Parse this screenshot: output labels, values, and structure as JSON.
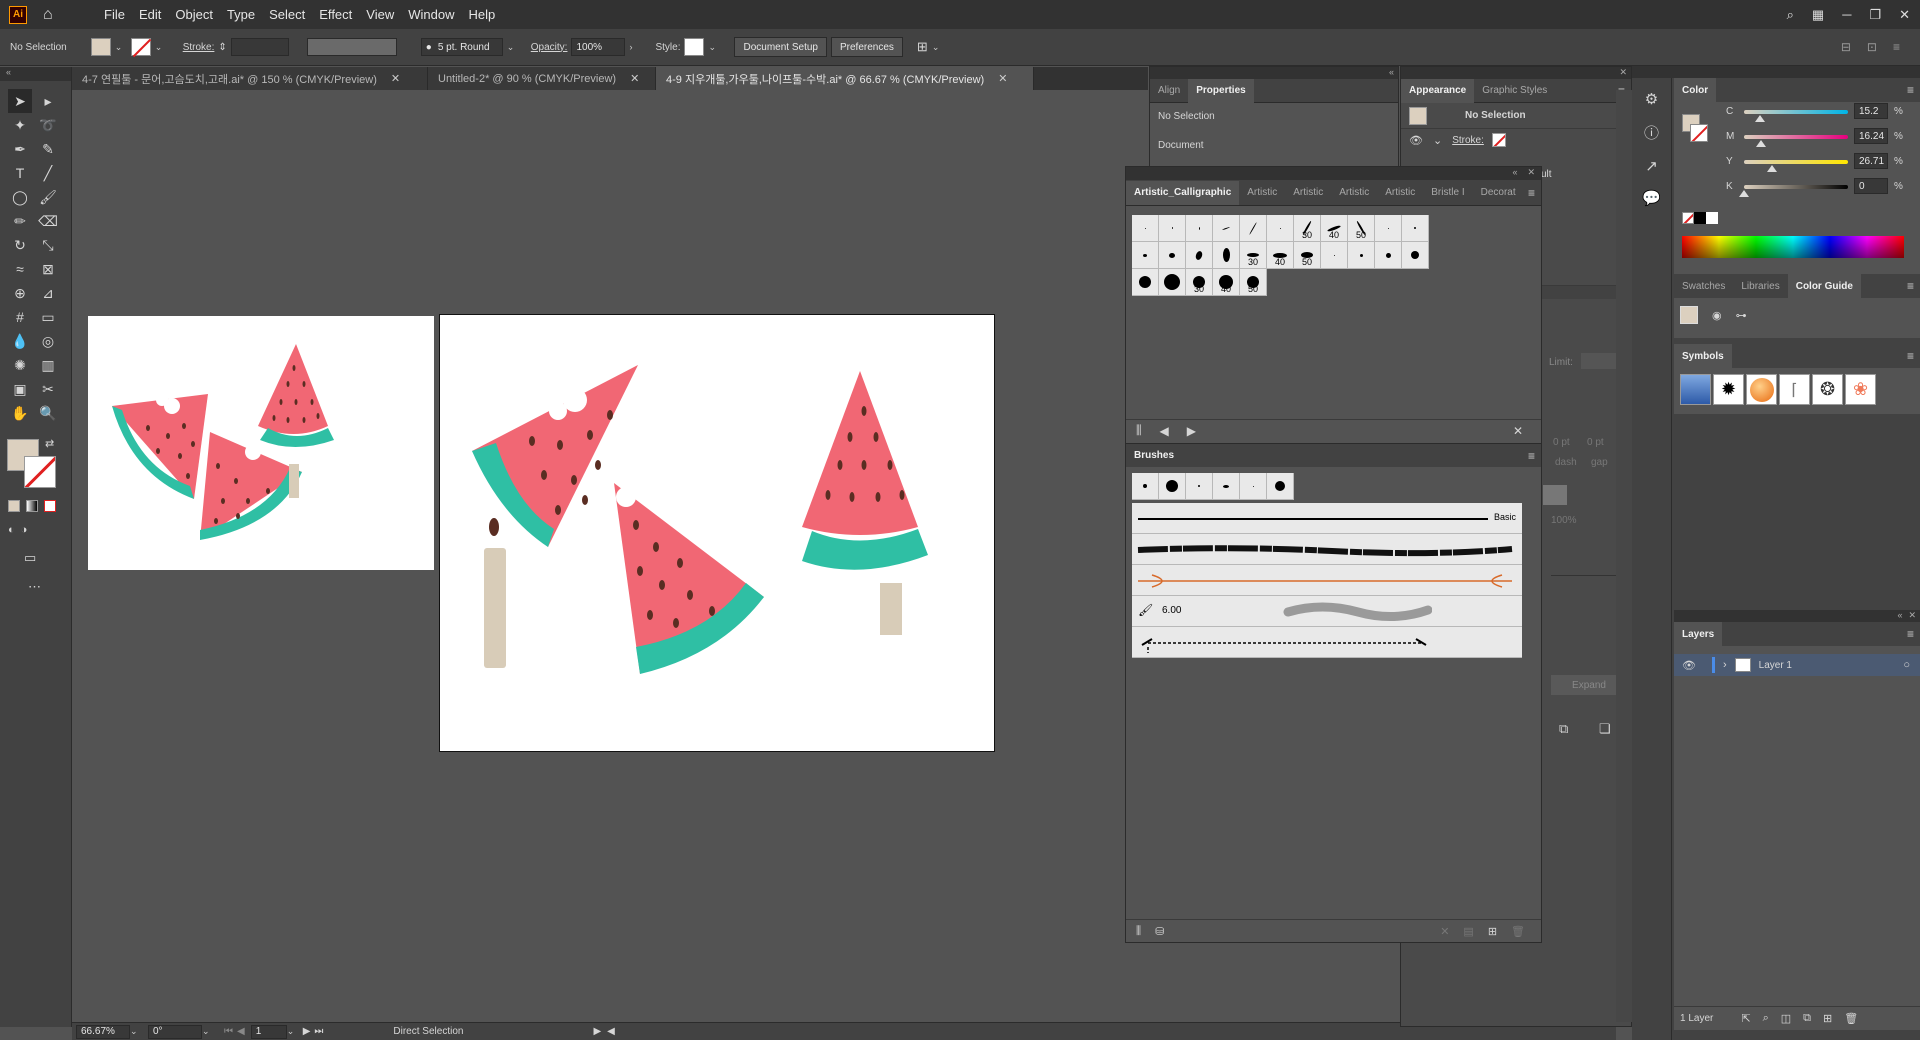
{
  "app": {
    "logo": "Ai",
    "menus": [
      "File",
      "Edit",
      "Object",
      "Type",
      "Select",
      "Effect",
      "View",
      "Window",
      "Help"
    ]
  },
  "control": {
    "selection": "No Selection",
    "stroke_label": "Stroke:",
    "brush_value": "5 pt. Round",
    "opacity_label": "Opacity:",
    "opacity_value": "100%",
    "style_label": "Style:",
    "doc_setup": "Document Setup",
    "preferences": "Preferences"
  },
  "tabs": [
    {
      "label": "4-7 연필툴 - 문어,고슴도치,고래.ai* @ 150 % (CMYK/Preview)",
      "active": false
    },
    {
      "label": "Untitled-2* @ 90 % (CMYK/Preview)",
      "active": false
    },
    {
      "label": "4-9 지우개툴,가우툴,나이프툴-수박.ai* @ 66.67 % (CMYK/Preview)",
      "active": true
    }
  ],
  "status": {
    "zoom": "66.67%",
    "rotation": "0°",
    "artboard": "1",
    "tool": "Direct Selection"
  },
  "properties_panel": {
    "tabs": [
      "Align",
      "Properties"
    ],
    "no_selection": "No Selection",
    "document": "Document"
  },
  "appearance_panel": {
    "tabs": [
      "Appearance",
      "Graphic Styles"
    ],
    "no_selection": "No Selection",
    "stroke": "Stroke:",
    "limit": "Limit:",
    "dash": "dash",
    "gap": "gap",
    "pt0": "0 pt",
    "pt1": "0 pt",
    "pct": "100%",
    "expand": "Expand",
    "ult": "ult"
  },
  "brush_library": {
    "tabs": [
      "Artistic_Calligraphic",
      "Artistic",
      "Artistic",
      "Artistic",
      "Artistic",
      "Bristle I",
      "Decorat"
    ],
    "row1_labels": [
      "",
      "",
      "",
      "",
      "",
      "",
      "30",
      "40",
      "50",
      "",
      ""
    ],
    "row2_labels": [
      "",
      "",
      "",
      "",
      "30",
      "40",
      "50",
      "",
      "",
      "",
      ""
    ],
    "row3_labels": [
      "",
      "",
      "30",
      "40",
      "50"
    ]
  },
  "brushes_panel": {
    "title": "Brushes",
    "basic": "Basic",
    "size": "6.00"
  },
  "color_panel": {
    "title": "Color",
    "channels": [
      {
        "name": "C",
        "value": "15.2",
        "pct": 0.152
      },
      {
        "name": "M",
        "value": "16.24",
        "pct": 0.1624
      },
      {
        "name": "Y",
        "value": "26.71",
        "pct": 0.2671
      },
      {
        "name": "K",
        "value": "0",
        "pct": 0
      }
    ],
    "percent": "%"
  },
  "swatch_tabs": [
    "Swatches",
    "Libraries",
    "Color Guide"
  ],
  "symbols": {
    "title": "Symbols"
  },
  "layers": {
    "title": "Layers",
    "layer_name": "Layer 1",
    "count": "1 Layer"
  },
  "colors": {
    "watermelon": "#f16774",
    "rind": "#2fbfa4",
    "stick": "#d8ccb8",
    "seed": "#5a2d22"
  }
}
